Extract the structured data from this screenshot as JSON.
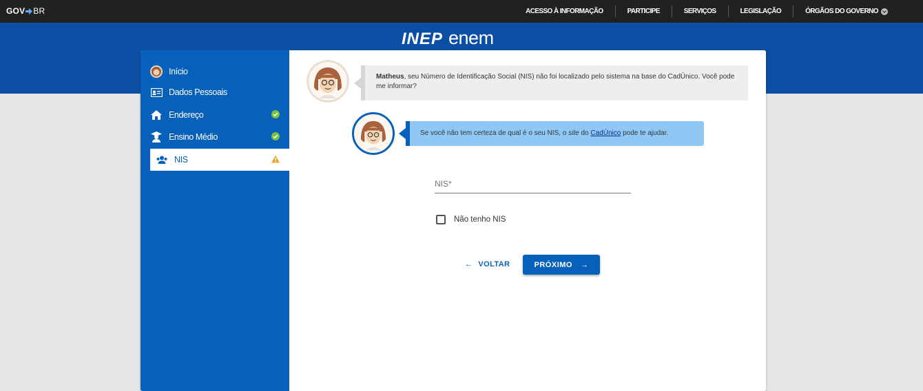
{
  "govbar": {
    "logo_gov": "GOV",
    "logo_br": "BR",
    "menu": [
      {
        "label": "ACESSO À INFORMAÇÃO"
      },
      {
        "label": "PARTICIPE"
      },
      {
        "label": "SERVIÇOS"
      },
      {
        "label": "LEGISLAÇÃO"
      },
      {
        "label": "ÓRGÃOS DO GOVERNO"
      }
    ]
  },
  "header": {
    "brand_inep": "INEP",
    "brand_enem": "enem"
  },
  "sidebar": {
    "items": [
      {
        "label": "Início",
        "icon": "avatar-icon",
        "status": ""
      },
      {
        "label": "Dados Pessoais",
        "icon": "id-card-icon",
        "status": ""
      },
      {
        "label": "Endereço",
        "icon": "home-icon",
        "status": "check"
      },
      {
        "label": "Ensino Médio",
        "icon": "graduate-icon",
        "status": "check"
      },
      {
        "label": "NIS",
        "icon": "people-icon",
        "status": "warning"
      }
    ]
  },
  "messages": {
    "first_name": "Matheus",
    "first_text": ", seu Número de Identificação Social (NIS) não foi localizado pelo sistema na base do CadÚnico. Você pode me informar?",
    "second_pre": "Se você não tem certeza de qual é o seu NIS, o ",
    "second_italic": "site",
    "second_mid": " do ",
    "second_link": "CadÚnico",
    "second_post": " pode te ajudar."
  },
  "form": {
    "nis_placeholder": "NIS*",
    "nis_value": "",
    "no_nis_label": "Não tenho NIS",
    "no_nis_checked": false
  },
  "actions": {
    "back_label": "VOLTAR",
    "next_label": "PRÓXIMO"
  },
  "colors": {
    "govbar": "#212121",
    "header_blue": "#0b4fa5",
    "sidebar_blue": "#0760b9",
    "success": "#7cc242",
    "warning": "#f0a030"
  }
}
